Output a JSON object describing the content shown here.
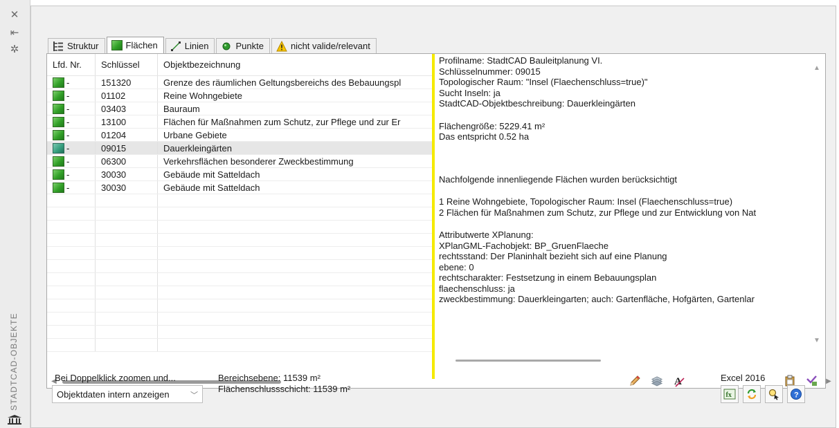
{
  "sidebar": {
    "vertical_title": "STADTCAD-OBJEKTE"
  },
  "tabs": [
    {
      "label": "Struktur"
    },
    {
      "label": "Flächen"
    },
    {
      "label": "Linien"
    },
    {
      "label": "Punkte"
    },
    {
      "label": "nicht valide/relevant"
    }
  ],
  "table": {
    "headers": [
      "Lfd. Nr.",
      "Schlüssel",
      "Objektbezeichnung"
    ],
    "rows": [
      {
        "nr": "-",
        "key": "151320",
        "name": "Grenze des räumlichen Geltungsbereichs des Bebauungspl"
      },
      {
        "nr": "-",
        "key": "01102",
        "name": "Reine Wohngebiete"
      },
      {
        "nr": "-",
        "key": "03403",
        "name": "Bauraum"
      },
      {
        "nr": "-",
        "key": "13100",
        "name": "Flächen für Maßnahmen zum Schutz, zur Pflege und zur Er"
      },
      {
        "nr": "-",
        "key": "01204",
        "name": "Urbane Gebiete"
      },
      {
        "nr": "-",
        "key": "09015",
        "name": "Dauerkleingärten"
      },
      {
        "nr": "-",
        "key": "06300",
        "name": "Verkehrsflächen besonderer Zweckbestimmung"
      },
      {
        "nr": "-",
        "key": "30030",
        "name": "Gebäude mit Satteldach"
      },
      {
        "nr": "-",
        "key": "30030",
        "name": "Gebäude mit Satteldach"
      }
    ]
  },
  "info": {
    "profile": "Profilname: StadtCAD Bauleitplanung VI.",
    "key_number": "Schlüsselnummer: 09015",
    "topo": "Topologischer Raum: \"Insel (Flaechenschluss=true)\"",
    "islands": "Sucht Inseln: ja",
    "description": "StadtCAD-Objektbeschreibung: Dauerkleingärten",
    "area": "Flächengröße: 5229.41 m²",
    "area_ha": "Das entspricht 0.52 ha",
    "inner_heading": "Nachfolgende innenliegende Flächen wurden berücksichtigt",
    "inner_1": "1 Reine Wohngebiete, Topologischer Raum: Insel (Flaechenschluss=true)",
    "inner_2": "2 Flächen für Maßnahmen zum Schutz, zur Pflege und zur Entwicklung von Nat",
    "attr_heading": "Attributwerte XPlanung:",
    "attr_fachobjekt": "XPlanGML-Fachobjekt: BP_GruenFlaeche",
    "attr_rechtsstand": "rechtsstand: Der Planinhalt bezieht sich auf eine Planung",
    "attr_ebene": "ebene: 0",
    "attr_rechtscharakter": "rechtscharakter: Festsetzung in einem Bebauungsplan",
    "attr_flaechenschluss": "flaechenschluss: ja",
    "attr_zweck": "zweckbestimmung: Dauerkleingarten; auch: Gartenfläche, Hofgärten, Gartenlar"
  },
  "footer": {
    "doubleclick_label": "Bei Doppelklick zoomen und...",
    "select_value": "Objektdaten intern anzeigen",
    "area_level": "Bereichsebene: 11539 m²",
    "area_closure": "Flächenschlussschicht: 11539 m²",
    "excel": "Excel 2016"
  },
  "colors": {
    "divider": "#f5ea00",
    "swatch_green": "#32a028",
    "swatch_teal": "#36a07f",
    "selection": "#e6e6e6"
  }
}
